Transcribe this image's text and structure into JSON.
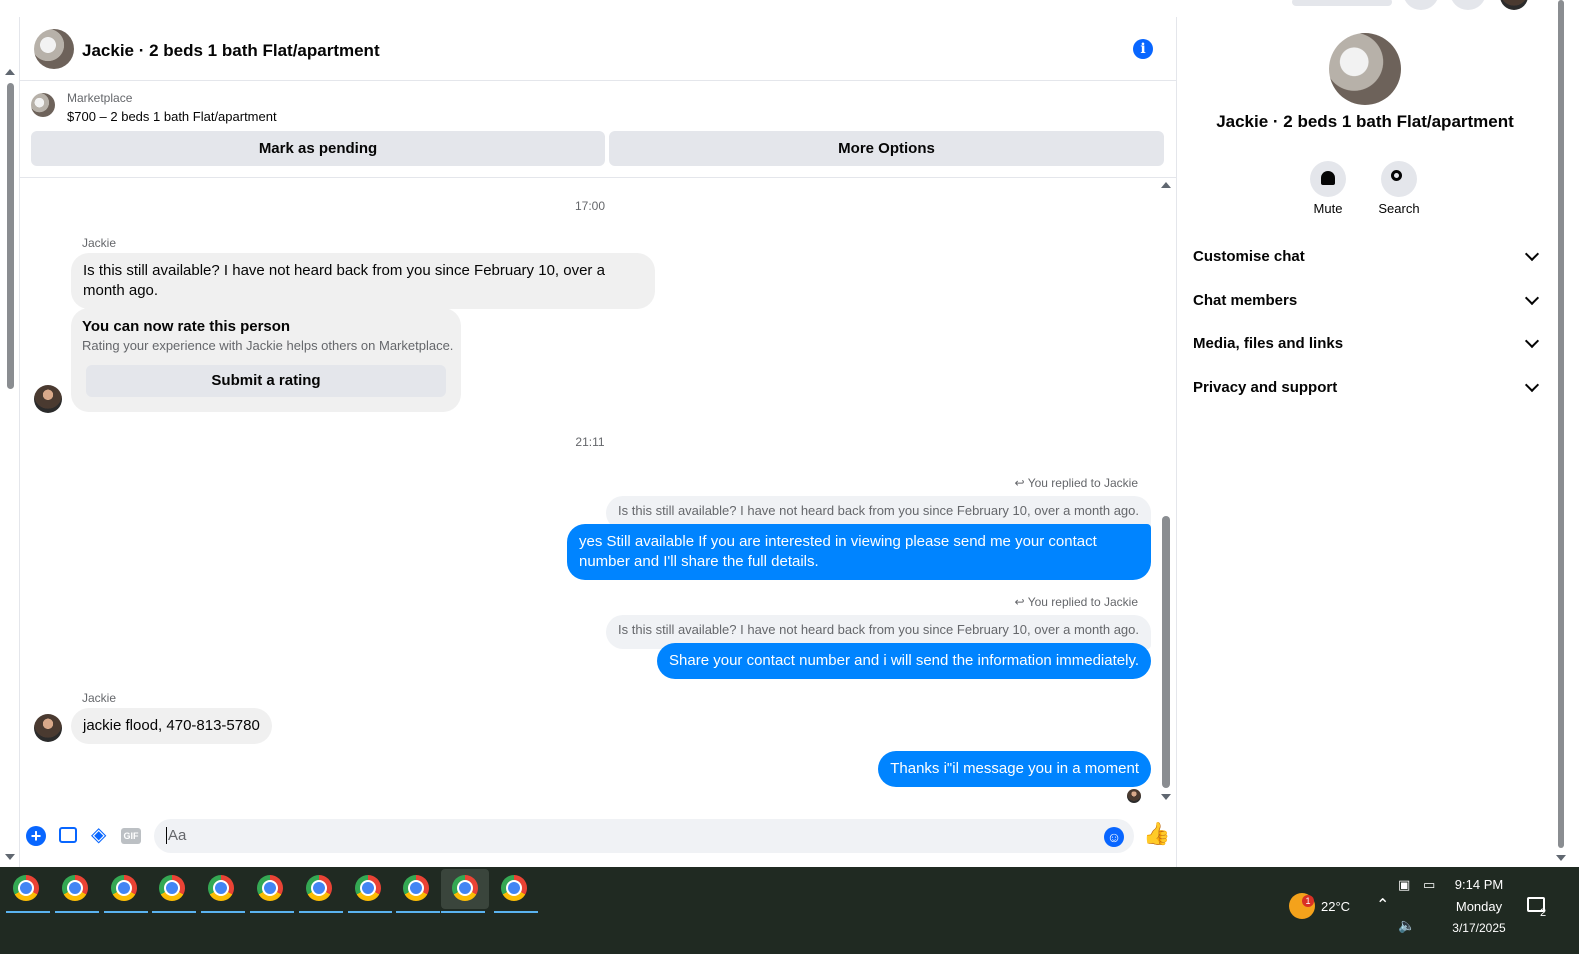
{
  "header": {
    "title": "Jackie · 2 beds 1 bath Flat/apartment"
  },
  "marketplace": {
    "label": "Marketplace",
    "listing": "$700 – 2 beds 1 bath Flat/apartment",
    "pending_button": "Mark as pending",
    "more_button": "More Options"
  },
  "messages": {
    "time1": "17:00",
    "sender1": "Jackie",
    "msg1": "Is this still available? I have not heard back from you since February 10, over a month ago.",
    "rate_title": "You can now rate this person",
    "rate_desc": "Rating your experience with Jackie helps others on Marketplace.",
    "rate_button": "Submit a rating",
    "time2": "21:11",
    "replied1": "You replied to Jackie",
    "quote1": "Is this still available? I have not heard back from you since February 10, over a month ago.",
    "reply1": "yes Still available If you are interested in viewing please send me your contact number and I'll share the full details.",
    "replied2": "You replied to Jackie",
    "quote2": "Is this still available? I have not heard back from you since February 10, over a month ago.",
    "reply2": "Share your contact number and i will send the information immediately.",
    "sender2": "Jackie",
    "msg2": "jackie flood, 470-813-5780",
    "reply3": "Thanks i\"il message you in a moment"
  },
  "composer": {
    "placeholder": "Aa",
    "gif_label": "GIF"
  },
  "panel": {
    "title": "Jackie · 2 beds 1 bath Flat/apartment",
    "mute_label": "Mute",
    "search_label": "Search",
    "sections": [
      "Customise chat",
      "Chat members",
      "Media, files and links",
      "Privacy and support"
    ]
  },
  "taskbar": {
    "app_count": 11,
    "weather_temp": "22°C",
    "weather_badge": "1",
    "time": "9:14 PM",
    "day": "Monday",
    "date": "3/17/2025",
    "notification_count": "2"
  },
  "colors": {
    "accent": "#0866ff",
    "outgoing_bubble": "#0084ff",
    "taskbar": "#202a22"
  }
}
